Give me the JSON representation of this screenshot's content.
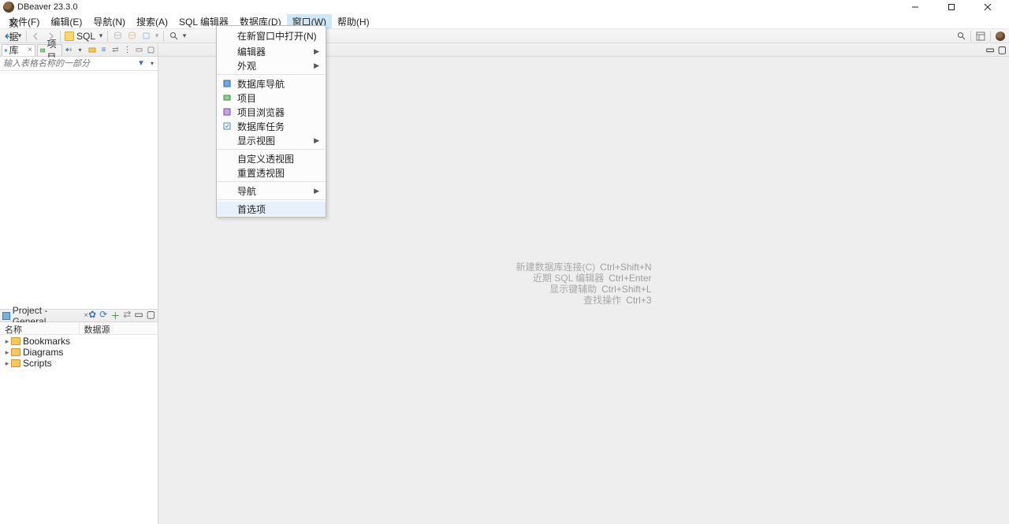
{
  "title": "DBeaver 23.3.0",
  "menubar": [
    "文件(F)",
    "编辑(E)",
    "导航(N)",
    "搜索(A)",
    "SQL 编辑器",
    "数据库(D)",
    "窗口(W)",
    "帮助(H)"
  ],
  "active_menu_index": 6,
  "toolbar": {
    "sql_label": "SQL"
  },
  "nav_tabs": {
    "tab1": "数据库导航",
    "tab2": "项目"
  },
  "filter_placeholder": "输入表格名称的一部分",
  "project_panel": {
    "title": "Project - General",
    "columns": [
      "名称",
      "数据源"
    ],
    "items": [
      "Bookmarks",
      "Diagrams",
      "Scripts"
    ]
  },
  "hints": [
    {
      "label": "新建数据库连接(C)",
      "key": "Ctrl+Shift+N"
    },
    {
      "label": "近期 SQL 编辑器",
      "key": "Ctrl+Enter"
    },
    {
      "label": "显示键辅助",
      "key": "Ctrl+Shift+L"
    },
    {
      "label": "查找操作",
      "key": "Ctrl+3"
    }
  ],
  "popup": {
    "items": [
      {
        "label": "在新窗口中打开(N)",
        "icon": null,
        "submenu": false
      },
      {
        "label": "编辑器",
        "icon": null,
        "submenu": true
      },
      {
        "label": "外观",
        "icon": null,
        "submenu": true
      },
      "---",
      {
        "label": "数据库导航",
        "icon": "db-nav",
        "submenu": false
      },
      {
        "label": "项目",
        "icon": "project",
        "submenu": false
      },
      {
        "label": "项目浏览器",
        "icon": "browser",
        "submenu": false
      },
      {
        "label": "数据库任务",
        "icon": "tasks",
        "submenu": false
      },
      {
        "label": "显示视图",
        "icon": null,
        "submenu": true
      },
      "---",
      {
        "label": "自定义透视图",
        "icon": null,
        "submenu": false
      },
      {
        "label": "重置透视图",
        "icon": null,
        "submenu": false
      },
      "---",
      {
        "label": "导航",
        "icon": null,
        "submenu": true
      },
      "---",
      {
        "label": "首选项",
        "icon": null,
        "submenu": false,
        "hover": true
      }
    ]
  }
}
